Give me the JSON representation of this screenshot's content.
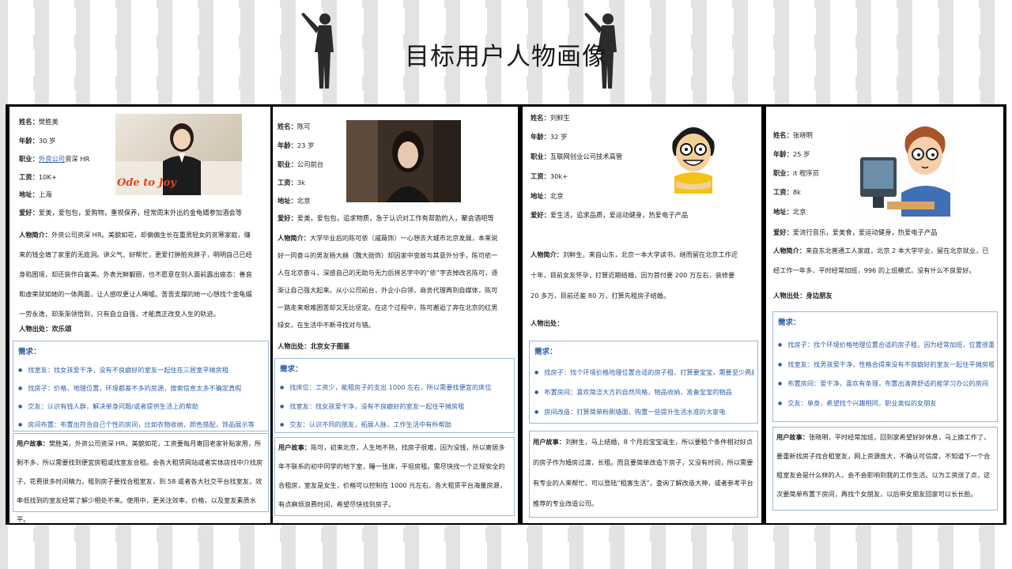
{
  "page_title": "目标用户人物画像",
  "labels": {
    "name": "姓名：",
    "age": "年龄：",
    "job": "职业：",
    "salary": "工资：",
    "address": "地址：",
    "hobby": "爱好：",
    "intro": "人物简介：",
    "source": "人物出处：",
    "needs": "需求：",
    "story": "用户故事："
  },
  "personas": [
    {
      "name": "樊胜美",
      "age": "30 岁",
      "job_link": "外资公司",
      "job_rest": "资深 HR",
      "salary": "10K+",
      "address": "上海",
      "hobby": "爱美，爱包包，爱购物，重视保养，经常周末外出约金龟婿参加酒会等",
      "intro": "外资公司资深 HR。美貌如花，却偏偏生长在重男轻女的贫寒家庭，赚来的钱全填了家里的无底洞。讲义气、好帮忙，更爱打肿脸充胖子，明明自己已经身陷困境，却还装作白富美。外表光鲜靓丽，也不愿意在别人面前露出疲态：善良和虚荣就如她的一体两面，让人感叹更让人唏嘘。苦苦支撑的她一心想找个金龟婿一劳永逸，却渐渐领悟到，只有自立自强，才能真正改变人生的轨迹。",
      "source": "欢乐颂",
      "photo_caption": "Ode to Joy",
      "needs": [
        "找室友：找女孩爱干净，没有不良癖好的室友一起住在三居室平摊房租",
        "找房子：价格，地理位置，环境都差不多的房源，搜索信息太多不确定真假",
        "交友：认识有钱人群，解决单身问题/或者提供生活上的帮助",
        "房间布置：布置出符合自己个性的房间，比如衣物收纳，颜色搭配，饰品展示等"
      ],
      "story": "樊胜美，外资公司资深 HR，美貌如花，工资要每月寄回老家补贴家用，所剩不多，所以需要找到便宜房租或找室友合租。会各大租赁网站或者实体店找中介找房子，花费很多时间精力，租到房子要找合租室友，到 58 或者各大社交平台找室友，效率低找到的室友经常了解少相处不来。使用中，更关注效率，价格，以及室友素质水平。"
    },
    {
      "name": "陈可",
      "age": "23 岁",
      "job": "公司前台",
      "salary": "3k",
      "address": "北京",
      "hobby": "爱美，爱包包，追求物质，急于认识对工作有帮助的人，聚会酒吧等",
      "intro": "大学毕业后的陈可依（戚薇饰）一心想去大城市北京发展，本来说好一同奋斗的男友杨大赫（魏大勋饰）却因家中变故与其意外分手，陈可依一人在北京奋斗，深感自己的无助与无力后将名字中的“依”字去掉改名陈可，逐渐让自己强大起来。从小公司前台，外企小白领，商务代理再到自媒体，陈可一路走来艰难困苦却又无比坚定。在这个过程中，陈可邂逅了奔在北京的红男绿女，在生活中不断寻找对与错。",
      "source": "北京女子图鉴",
      "needs": [
        "找床位：工资少，能租房子的支出 1000 左右，所以需要找便宜的床位",
        "找室友：找女孩爱干净，没有不良癖好的室友一起住平摊房租",
        "交友：认识不同的朋友，拓展人脉，工作生活中有所帮助"
      ],
      "story": "陈可，初来北京，人生地不熟，找房子很难，因为没钱，所以寄居多年不联系的初中同学的地下室，睡一张床，平坦房租。需尽快找一个正规安全的合租房，室友是女生，价格可以控制在 1000 元左右，各大租赁平台海量房源，有点麻烦浪费时间，希望尽快找到房子。"
    },
    {
      "name": "刘鲜生",
      "age": "32 岁",
      "job": "互联网创业公司技术高管",
      "salary": "30k+",
      "address": "北京",
      "hobby": "爱生活，追求品质，爱运动健身，热爱电子产品",
      "intro": "刘鲜生，来自山东，北京一本大学读书，继而留在北京工作近十年，目前女友怀孕，打算近期结婚，因为首付要 200 万左右，装修要 20 多万，目前还差 80 万，打算先租房子结婚。",
      "source": "",
      "needs": [
        "找房子：找个环境价格地理位置合适的房子租，打算要宝宝，需要至少两居室",
        "布置房间：喜欢简洁大方的自然风格，物品收纳，准备宝宝的物品",
        "房间改造：打算简单粉刷墙面，购置一些提升生活水准的大家电"
      ],
      "story": "刘鲜生，马上结婚，8 个月后宝宝诞生，所以要租个条件相对好点的房子作为婚房过渡，长租。而且要简单改造下房子，又没有时间，所以需要有专业的人来帮忙，可以登陆“租客生活”，查询了解改造大神，或者参考平台推荐的专业改造公司。"
    },
    {
      "name": "张晓明",
      "age": "25 岁",
      "job": "it 程序员",
      "salary": "8k",
      "address": "北京",
      "hobby": "爱流行音乐，爱美食，爱运动健身，热爱电子产品",
      "intro": "来自东北普通工人家庭，北京 2 本大学毕业，留在北京就业，已经工作一年多，平时经常加班，996 的上班模式，没有什么不良爱好。",
      "source": "身边朋友",
      "needs": [
        "找房子：找个环境价格地理位置合适的房子租，因为经常加班，位置很重要",
        "找室友：找男孩爱干净，性格合得来没有不良癖好的室友一起住平摊房租",
        "布置房间：爱干净，喜欢有条理，布置出清爽舒适的能学习办公的房间",
        "交友：单身，希望找个兴趣相同，职业类似的女朋友"
      ],
      "story": "张晓明，平时经常加班，回到家希望好好休息，马上换工作了，要重新找房子找合租室友，网上资源庞大，不确认可信度，不知道下一个合租室友会是什么样的人，会不会影响到我的工作生活。以为工资涨了点，这次要简单布置下房间，再找个女朋友，以后带女朋友回家可以长长脸。"
    }
  ],
  "colors": {
    "accent": "#2e5fa8",
    "border": "#9bb6df",
    "board": "#000000"
  }
}
